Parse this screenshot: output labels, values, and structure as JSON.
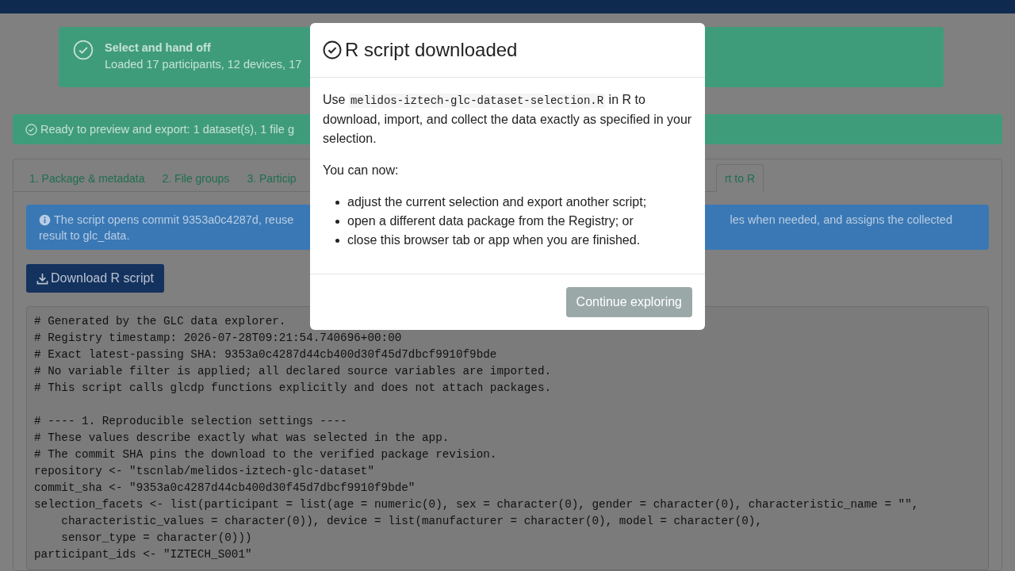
{
  "notice": {
    "title": "Select and hand off",
    "message": "Loaded 17 participants, 12 devices, 17"
  },
  "status_alert": {
    "message": "Ready to preview and export: 1 dataset(s), 1 file g"
  },
  "tabs": [
    {
      "label": "1. Package & metadata",
      "selected": false
    },
    {
      "label": "2. File groups",
      "selected": false
    },
    {
      "label": "3. Particip",
      "selected": false
    },
    {
      "label": "rt to R",
      "selected": true
    }
  ],
  "info_alert": {
    "line_1_left": "The script opens commit 9353a0c4287d, reuse",
    "line_1_right": "les when needed, and assigns the collected",
    "line_2": "result to glc_data."
  },
  "download_button": "Download R script",
  "code_blocks": [
    [
      "# Generated by the GLC data explorer.",
      "# Registry timestamp: 2026-07-28T09:21:54.740696+00:00",
      "# Exact latest-passing SHA: 9353a0c4287d44cb400d30f45d7dbcf9910f9bde",
      "# No variable filter is applied; all declared source variables are imported.",
      "# This script calls glcdp functions explicitly and does not attach packages."
    ],
    [
      "# ---- 1. Reproducible selection settings ----",
      "# These values describe exactly what was selected in the app.",
      "# The commit SHA pins the download to the verified package revision.",
      "repository <- \"tscnlab/melidos-iztech-glc-dataset\"",
      "commit_sha <- \"9353a0c4287d44cb400d30f45d7dbcf9910f9bde\"",
      "selection_facets <- list(participant = list(age = numeric(0), sex = character(0), gender = character(0), characteristic_name = \"\",",
      "    characteristic_values = character(0)), device = list(manufacturer = character(0), model = character(0),",
      "    sensor_type = character(0)))",
      "participant_ids <- \"IZTECH_S001\""
    ]
  ],
  "modal": {
    "title": "R script downloaded",
    "message_before": "Use",
    "file_name": "melidos-iztech-glc-dataset-selection.R",
    "message_after": "in R to download, import, and collect the data exactly as specified in your selection.",
    "subheading": "You can now:",
    "options": [
      "adjust the current selection and export another script;",
      "open a different data package from the Registry; or",
      "close this browser tab or app when you are finished."
    ],
    "button": "Continue exploring"
  }
}
